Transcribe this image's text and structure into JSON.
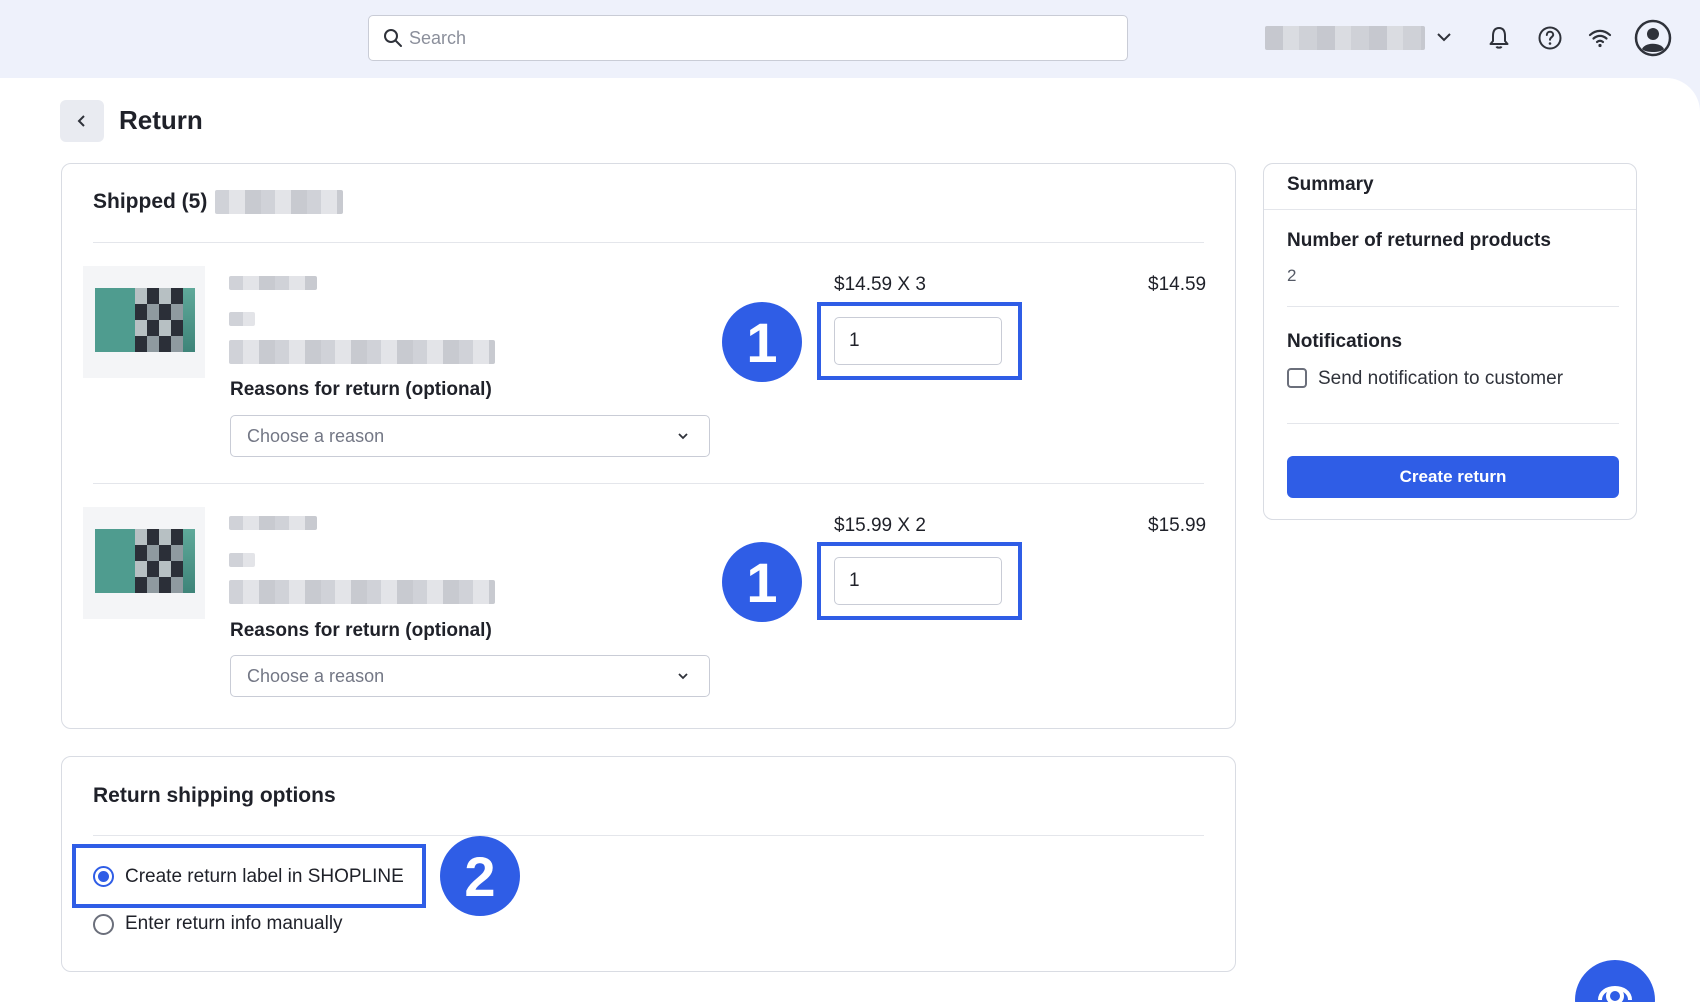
{
  "header": {
    "search_placeholder": "Search",
    "icons": [
      "search-icon",
      "chevron-down-icon",
      "bell-icon",
      "help-icon",
      "wifi-icon",
      "avatar-icon"
    ]
  },
  "page": {
    "title": "Return"
  },
  "shipped": {
    "title": "Shipped (5)",
    "items": [
      {
        "price_line": "$14.59 X 3",
        "total": "$14.59",
        "qty_value": "1",
        "reason_label": "Reasons for return (optional)",
        "reason_placeholder": "Choose a reason",
        "badge": "1"
      },
      {
        "price_line": "$15.99 X 2",
        "total": "$15.99",
        "qty_value": "1",
        "reason_label": "Reasons for return (optional)",
        "reason_placeholder": "Choose a reason",
        "badge": "1"
      }
    ]
  },
  "shipping_options": {
    "title": "Return shipping options",
    "options": [
      {
        "label": "Create return label in SHOPLINE",
        "selected": true
      },
      {
        "label": "Enter return info manually",
        "selected": false
      }
    ],
    "badge": "2"
  },
  "summary": {
    "title": "Summary",
    "returned_label": "Number of returned products",
    "returned_value": "2",
    "notifications_label": "Notifications",
    "notify_checkbox_label": "Send notification to customer",
    "notify_checked": false,
    "create_button": "Create return"
  },
  "colors": {
    "accent": "#2f5de6",
    "background": "#eef1fb"
  }
}
